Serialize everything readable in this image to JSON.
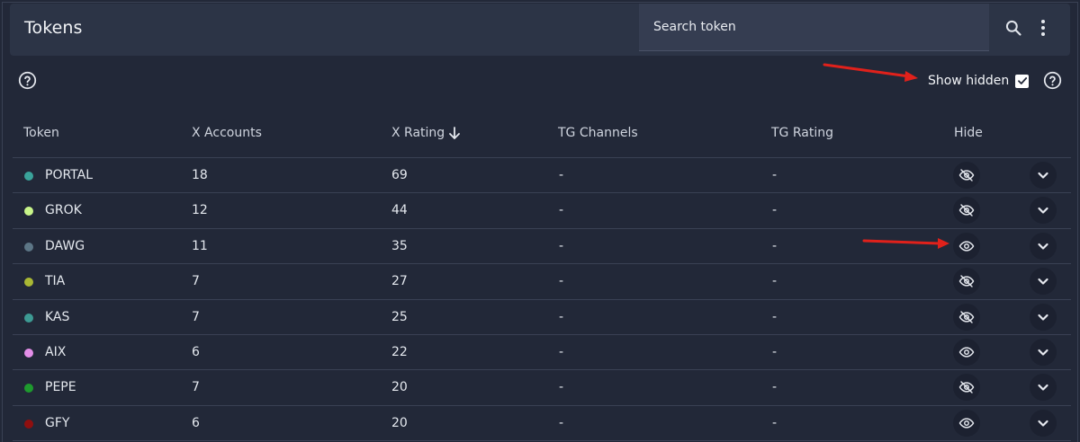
{
  "header": {
    "title": "Tokens",
    "search_placeholder": "Search token"
  },
  "filters": {
    "show_hidden_label": "Show hidden",
    "show_hidden_checked": true
  },
  "table": {
    "columns": [
      "Token",
      "X Accounts",
      "X Rating",
      "TG Channels",
      "TG Rating",
      "Hide"
    ],
    "sorted_column": "X Rating",
    "sort_direction": "descending",
    "rows": [
      {
        "token": "PORTAL",
        "color": "#3aa39a",
        "x_accounts": "18",
        "x_rating": "69",
        "tg_channels": "-",
        "tg_rating": "-",
        "hide_icon": "eye-off-icon"
      },
      {
        "token": "GROK",
        "color": "#c8f58a",
        "x_accounts": "12",
        "x_rating": "44",
        "tg_channels": "-",
        "tg_rating": "-",
        "hide_icon": "eye-off-icon"
      },
      {
        "token": "DAWG",
        "color": "#5d7686",
        "x_accounts": "11",
        "x_rating": "35",
        "tg_channels": "-",
        "tg_rating": "-",
        "hide_icon": "eye-icon"
      },
      {
        "token": "TIA",
        "color": "#a9b834",
        "x_accounts": "7",
        "x_rating": "27",
        "tg_channels": "-",
        "tg_rating": "-",
        "hide_icon": "eye-off-icon"
      },
      {
        "token": "KAS",
        "color": "#3d9a93",
        "x_accounts": "7",
        "x_rating": "25",
        "tg_channels": "-",
        "tg_rating": "-",
        "hide_icon": "eye-off-icon"
      },
      {
        "token": "AIX",
        "color": "#e38ee8",
        "x_accounts": "6",
        "x_rating": "22",
        "tg_channels": "-",
        "tg_rating": "-",
        "hide_icon": "eye-icon"
      },
      {
        "token": "PEPE",
        "color": "#1e9a2e",
        "x_accounts": "7",
        "x_rating": "20",
        "tg_channels": "-",
        "tg_rating": "-",
        "hide_icon": "eye-off-icon"
      },
      {
        "token": "GFY",
        "color": "#8f0f0f",
        "x_accounts": "6",
        "x_rating": "20",
        "tg_channels": "-",
        "tg_rating": "-",
        "hide_icon": "eye-icon"
      }
    ]
  },
  "annotations": {
    "arrow_color": "#e0211b"
  }
}
